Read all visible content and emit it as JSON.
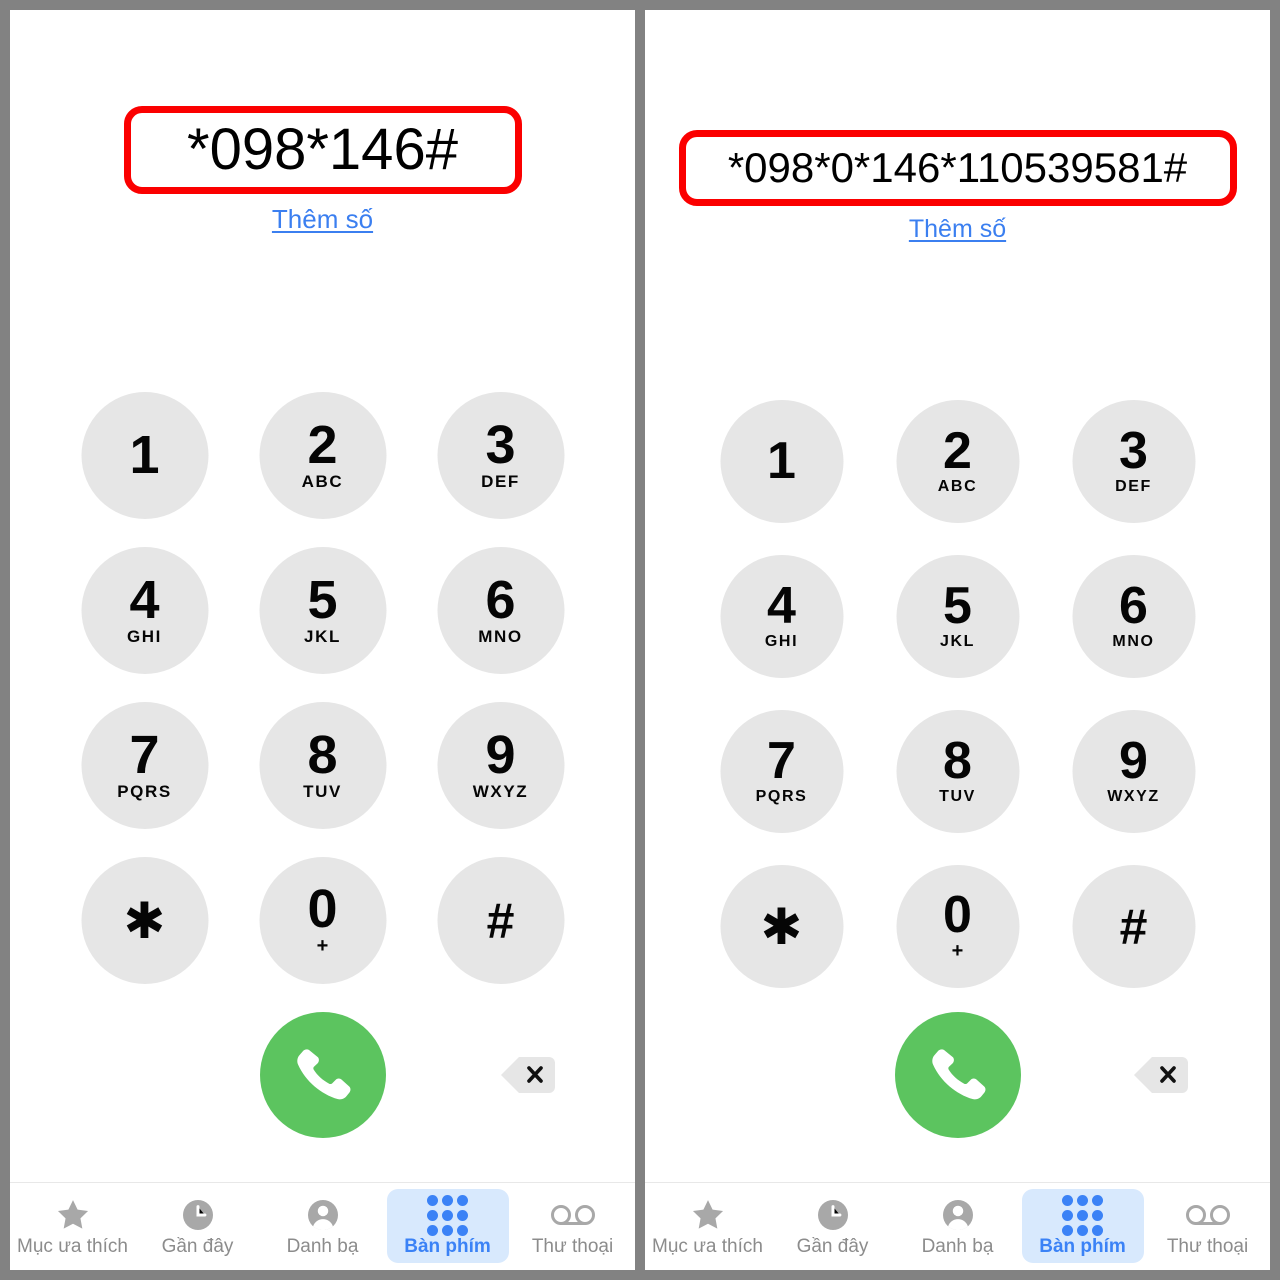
{
  "colors": {
    "outer_border": "#828282",
    "key_bg": "#e6e6e6",
    "call_green": "#5cc45f",
    "link_blue": "#3b7ff0",
    "active_tab_blue": "#3b82f6",
    "active_tab_bg": "#d8e9fd",
    "highlight_red": "#fb0000",
    "tab_gray": "#8c8c8c"
  },
  "panels": [
    {
      "id": "left",
      "display": {
        "number": "*098*146#",
        "add_number_label": "Thêm số",
        "highlighted": true
      }
    },
    {
      "id": "right",
      "display": {
        "number": "*098*0*146*110539581#",
        "add_number_label": "Thêm số",
        "highlighted": true
      }
    }
  ],
  "keypad": [
    {
      "digit": "1",
      "letters": ""
    },
    {
      "digit": "2",
      "letters": "ABC"
    },
    {
      "digit": "3",
      "letters": "DEF"
    },
    {
      "digit": "4",
      "letters": "GHI"
    },
    {
      "digit": "5",
      "letters": "JKL"
    },
    {
      "digit": "6",
      "letters": "MNO"
    },
    {
      "digit": "7",
      "letters": "PQRS"
    },
    {
      "digit": "8",
      "letters": "TUV"
    },
    {
      "digit": "9",
      "letters": "WXYZ"
    },
    {
      "digit": "✱",
      "letters": ""
    },
    {
      "digit": "0",
      "letters": "+"
    },
    {
      "digit": "#",
      "letters": ""
    }
  ],
  "actions": {
    "call_icon": "phone-handset-icon",
    "delete_icon": "backspace-delete-icon"
  },
  "tabbar": {
    "tabs": [
      {
        "label": "Mục ưa thích",
        "icon": "star-icon",
        "active": false
      },
      {
        "label": "Gần đây",
        "icon": "clock-icon",
        "active": false
      },
      {
        "label": "Danh bạ",
        "icon": "person-circle-icon",
        "active": false
      },
      {
        "label": "Bàn phím",
        "icon": "keypad-dots-icon",
        "active": true
      },
      {
        "label": "Thư thoại",
        "icon": "voicemail-icon",
        "active": false
      }
    ]
  }
}
